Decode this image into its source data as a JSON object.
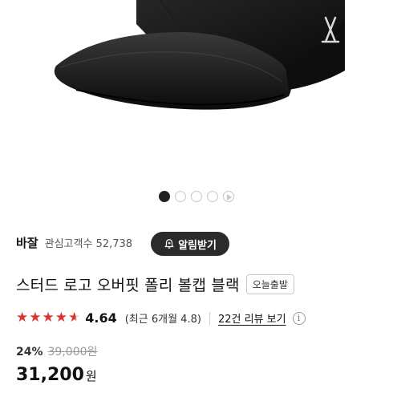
{
  "product_image": {
    "alt": "black ball cap with logo"
  },
  "gallery": {
    "pages": 4,
    "current": 1,
    "has_video": true
  },
  "store": {
    "name": "바잘",
    "followers": "관심고객수 52,738",
    "alarm_label": "알림받기"
  },
  "product": {
    "title": "스터드 로고 오버핏 폴리 볼캡 블랙",
    "badge": "오늘출발"
  },
  "rating": {
    "stars": 4.64,
    "score": "4.64",
    "recent": "(최근 6개월 4.8)",
    "review_link": "22건 리뷰 보기",
    "info": "i"
  },
  "price": {
    "discount": "24%",
    "original": "39,000원",
    "sale": "31,200",
    "currency": "원"
  },
  "colors": {
    "star": "#e0342f",
    "alarm_bg": "#2b2b2b"
  }
}
